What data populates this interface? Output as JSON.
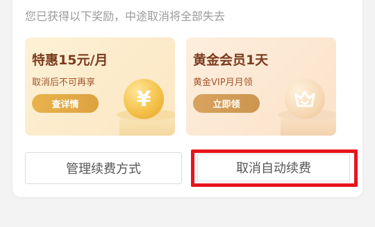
{
  "notice": "您已获得以下奖励，中途取消将全部失去",
  "benefits": [
    {
      "title": "特惠15元/月",
      "subtitle": "取消后不可再享",
      "button_label": "查详情",
      "icon_symbol": "¥",
      "icon": "yen-coin-icon"
    },
    {
      "title": "黄金会员1天",
      "subtitle": "黄金VIP月月领",
      "button_label": "立即领",
      "icon": "crown-coin-icon"
    }
  ],
  "actions": {
    "manage_label": "管理续费方式",
    "cancel_label": "取消自动续费"
  },
  "colors": {
    "highlight_border": "#e8141c",
    "gold_button": "#e9b24d",
    "bronze_button": "#d8a35e",
    "title_text": "#7a3b1e"
  }
}
